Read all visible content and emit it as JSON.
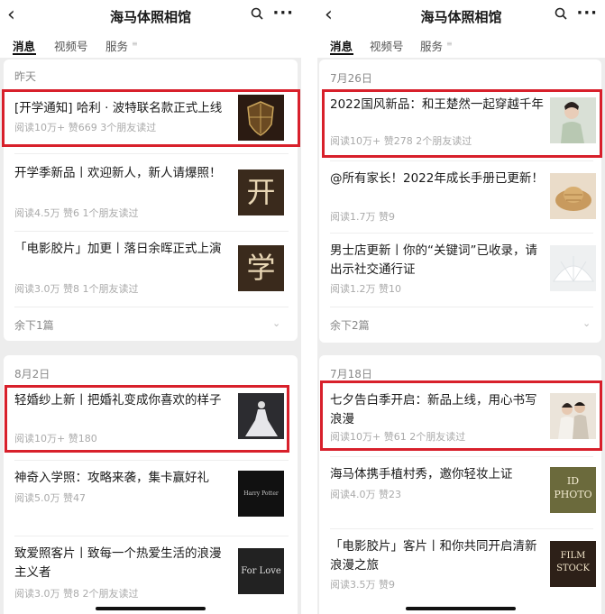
{
  "left": {
    "header": {
      "back_icon": "chevron-left-icon",
      "title": "海马体照相馆",
      "search_icon": "search-icon",
      "more_label": "···"
    },
    "tabs": [
      {
        "label": "消息"
      },
      {
        "label": "视频号"
      },
      {
        "label": "服务"
      }
    ],
    "groups": [
      {
        "date": "昨天",
        "items": [
          {
            "title": "[开学通知] 哈利 · 波特联名款正式上线",
            "meta": "阅读10万+  赞669  3个朋友读过",
            "thumb": "hogwarts-crest"
          },
          {
            "title": "开学季新品丨欢迎新人，新人请爆照！",
            "meta": "阅读4.5万  赞6  1个朋友读过",
            "thumb_text": "开"
          },
          {
            "title": "「电影胶片」加更丨落日余晖正式上演",
            "meta": "阅读3.0万  赞8  1个朋友读过",
            "thumb_text": "学"
          }
        ],
        "more": "余下1篇"
      },
      {
        "date": "8月2日",
        "items": [
          {
            "title": "轻婚纱上新丨把婚礼变成你喜欢的样子",
            "meta": "阅读10万+  赞180",
            "thumb": "wedding-dress"
          },
          {
            "title": "神奇入学照：攻略来袭，集卡赢好礼",
            "meta": "阅读5.0万  赞47",
            "thumb_text": "Harry Potter"
          },
          {
            "title": "致爱照客片丨致每一个热爱生活的浪漫主义者",
            "meta": "阅读3.0万  赞8  2个朋友读过",
            "thumb_text": "For Love"
          }
        ]
      }
    ]
  },
  "right": {
    "header": {
      "back_icon": "chevron-left-icon",
      "title": "海马体照相馆",
      "search_icon": "search-icon",
      "more_label": "···"
    },
    "tabs": [
      {
        "label": "消息"
      },
      {
        "label": "视频号"
      },
      {
        "label": "服务"
      }
    ],
    "groups": [
      {
        "date": "7月26日",
        "items": [
          {
            "title": "2022国风新品：和王楚然一起穿越千年",
            "meta": "阅读10万+  赞278  2个朋友读过",
            "thumb": "hanfu-portrait"
          },
          {
            "title": "@所有家长！2022年成长手册已更新！",
            "meta": "阅读1.7万  赞9",
            "thumb": "straw-hat"
          },
          {
            "title": "男士店更新丨你的“关键词”已收录，请出示社交通行证",
            "meta": "阅读1.2万  赞10",
            "thumb": "paper-fan"
          }
        ],
        "more": "余下2篇"
      },
      {
        "date": "7月18日",
        "items": [
          {
            "title": "七夕告白季开启：新品上线，用心书写浪漫",
            "meta": "阅读10万+  赞61  2个朋友读过",
            "thumb": "couple-photo"
          },
          {
            "title": "海马体携手植村秀，邀你轻妆上证",
            "meta": "阅读4.0万  赞23",
            "thumb_text": "ID PHOTO"
          },
          {
            "title": "「电影胶片」客片丨和你共同开启清新浪漫之旅",
            "meta": "阅读3.5万  赞9",
            "thumb_text": "FILM STOCK"
          }
        ]
      }
    ]
  }
}
